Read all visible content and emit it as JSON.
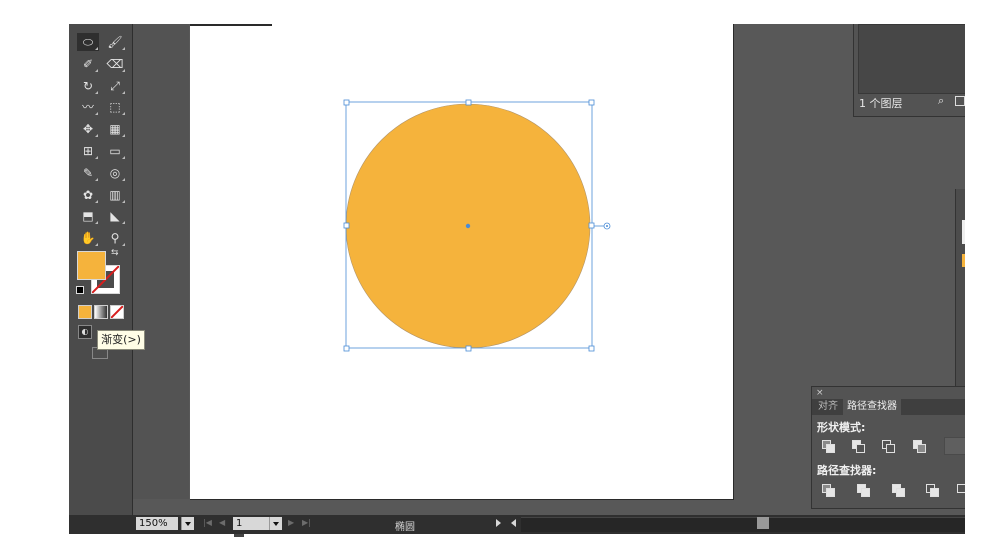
{
  "colors": {
    "fill": "#f5b33c",
    "selection": "#4a8cd6",
    "workspace": "#585858",
    "panel": "#535353"
  },
  "toolbar": {
    "tools": [
      {
        "name": "ellipse-tool",
        "glyph": "⬭"
      },
      {
        "name": "paintbrush-tool",
        "glyph": "🖌"
      },
      {
        "name": "blob-brush-tool",
        "glyph": "✐"
      },
      {
        "name": "eraser-tool",
        "glyph": "⌫"
      },
      {
        "name": "rotate-tool",
        "glyph": "↻"
      },
      {
        "name": "scale-tool",
        "glyph": "⤢"
      },
      {
        "name": "warp-tool",
        "glyph": "〰"
      },
      {
        "name": "free-transform-tool",
        "glyph": "⬚"
      },
      {
        "name": "shape-builder-tool",
        "glyph": "✥"
      },
      {
        "name": "perspective-grid-tool",
        "glyph": "▦"
      },
      {
        "name": "mesh-tool",
        "glyph": "⊞"
      },
      {
        "name": "gradient-tool",
        "glyph": "▭"
      },
      {
        "name": "eyedropper-tool",
        "glyph": "✎"
      },
      {
        "name": "blend-tool",
        "glyph": "◎"
      },
      {
        "name": "symbol-sprayer-tool",
        "glyph": "✿"
      },
      {
        "name": "column-graph-tool",
        "glyph": "▥"
      },
      {
        "name": "artboard-tool",
        "glyph": "⬒"
      },
      {
        "name": "slice-tool",
        "glyph": "◣"
      },
      {
        "name": "hand-tool",
        "glyph": "✋"
      },
      {
        "name": "zoom-tool",
        "glyph": "⚲"
      }
    ],
    "tooltip": "渐变(>)"
  },
  "layers_panel": {
    "count_label": "1 个图层"
  },
  "pathfinder_panel": {
    "close": "×",
    "tabs": [
      {
        "label": "对齐",
        "active": false
      },
      {
        "label": "路径查找器",
        "active": true
      }
    ],
    "shape_modes_label": "形状模式:",
    "pathfinders_label": "路径查找器:"
  },
  "statusbar": {
    "zoom": "150%",
    "page": "1",
    "tool_status": "椭圆"
  }
}
